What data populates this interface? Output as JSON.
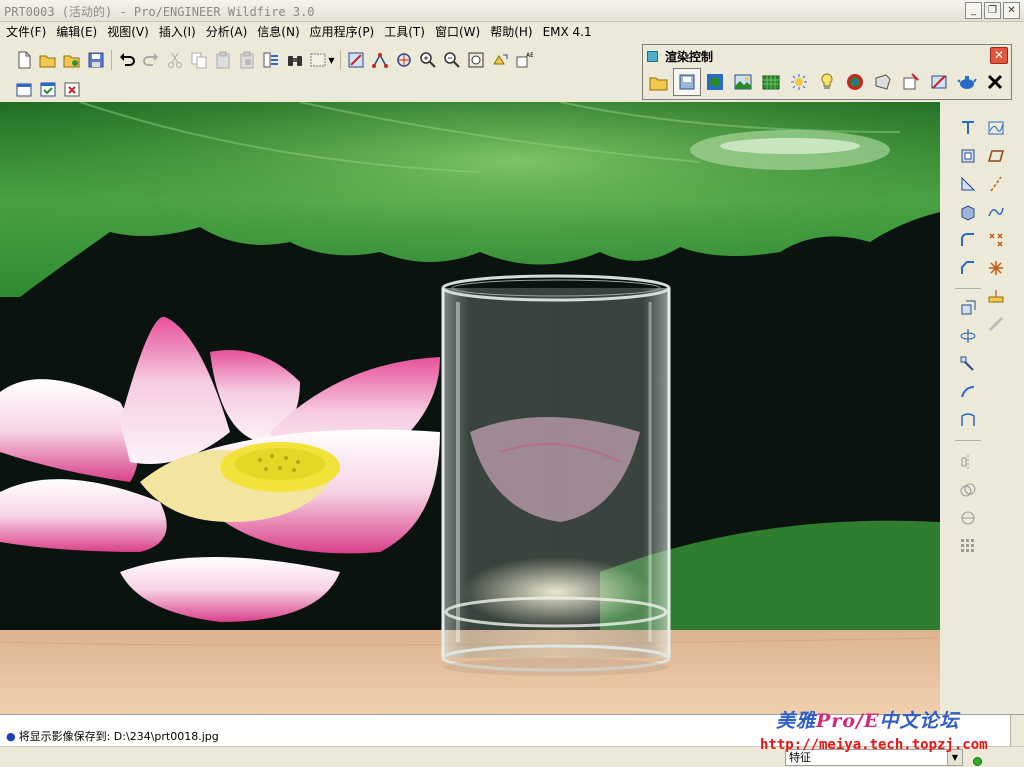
{
  "window": {
    "title": "PRT0003 (活动的) - Pro/ENGINEER Wildfire 3.0",
    "minimize": "_",
    "maximize": "❐",
    "close": "✕"
  },
  "menu": [
    "文件(F)",
    "编辑(E)",
    "视图(V)",
    "插入(I)",
    "分析(A)",
    "信息(N)",
    "应用程序(P)",
    "工具(T)",
    "窗口(W)",
    "帮助(H)",
    "EMX 4.1"
  ],
  "render_panel": {
    "title": "渲染控制",
    "close_label": "✕"
  },
  "message": {
    "bullet": "●",
    "text": "将显示影像保存到: D:\\234\\prt0018.jpg"
  },
  "status": {
    "filter_value": "特征",
    "filter_arrow": "▼"
  },
  "watermark": {
    "line1_a": "美雅",
    "line1_pro": "Pro/E",
    "line1_b": "中文论坛",
    "line2": "http://meiya.tech.topzj.com"
  },
  "colors": {
    "accent_blue": "#2f5ec4",
    "watermark_red": "#e81515",
    "status_green": "#2fae2f"
  }
}
